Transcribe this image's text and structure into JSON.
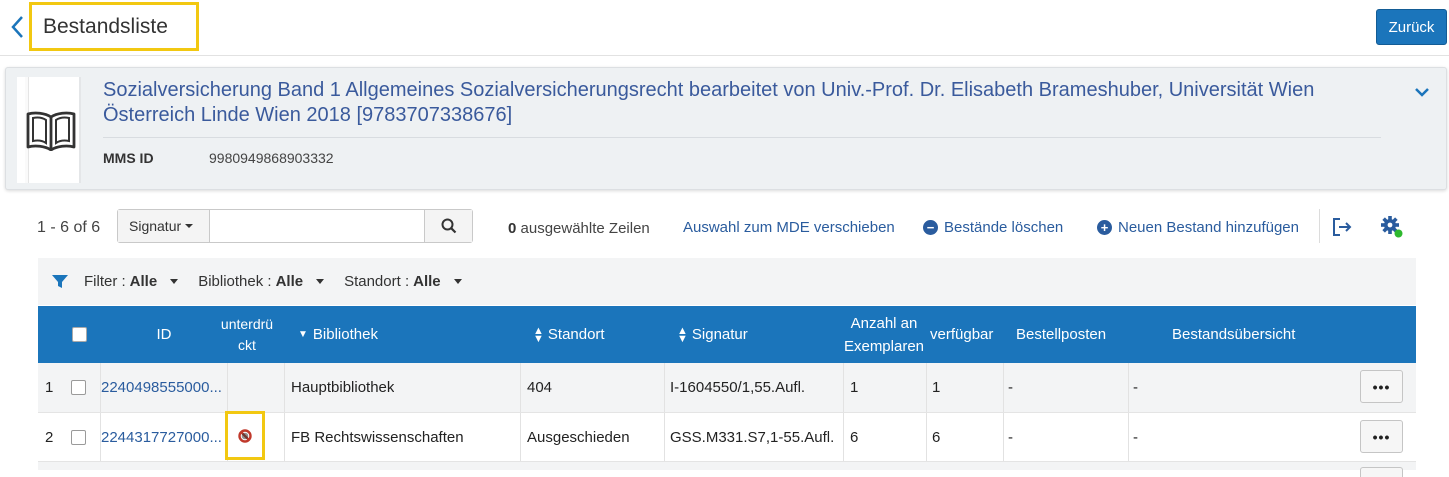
{
  "header": {
    "title": "Bestandsliste",
    "back_button_label": "Zurück"
  },
  "record": {
    "title": "Sozialversicherung Band 1 Allgemeines Sozialversicherungsrecht bearbeitet von Univ.-Prof. Dr. Elisabeth Brameshuber, Universität Wien Österreich Linde Wien 2018 [9783707338676]",
    "mms_label": "MMS ID",
    "mms_value": "9980949868903332",
    "thumbnail_icon": "book-icon"
  },
  "toolbar": {
    "count": "1 - 6 of 6",
    "search_field_select": "Signatur",
    "search_value": "",
    "selected_count": "0",
    "selected_text": "ausgewählte Zeilen",
    "move_to_mde": "Auswahl zum MDE verschieben",
    "delete_holdings": "Bestände löschen",
    "add_holding": "Neuen Bestand hinzufügen"
  },
  "filters": [
    {
      "label": "Filter :",
      "value": "Alle"
    },
    {
      "label": "Bibliothek :",
      "value": "Alle"
    },
    {
      "label": "Standort :",
      "value": "Alle"
    }
  ],
  "table": {
    "columns": {
      "id": "ID",
      "suppressed_line1": "unterdrü",
      "suppressed_line2": "ckt",
      "library": "Bibliothek",
      "location": "Standort",
      "call_number": "Signatur",
      "copies_line1": "Anzahl an",
      "copies_line2": "Exemplaren",
      "available": "verfügbar",
      "orders": "Bestellposten",
      "overview": "Bestandsübersicht"
    },
    "rows": [
      {
        "num": "1",
        "id": "2240498555000...",
        "suppressed": false,
        "library": "Hauptbibliothek",
        "location": "404",
        "call_number": "I-1604550/1,55.Aufl.",
        "copies": "1",
        "available": "1",
        "orders": "-",
        "overview": "-"
      },
      {
        "num": "2",
        "id": "2244317727000...",
        "suppressed": true,
        "library": "FB Rechtswissenschaften",
        "location": "Ausgeschieden",
        "call_number": "GSS.M331.S7,1-55.Aufl.",
        "copies": "6",
        "available": "6",
        "orders": "-",
        "overview": "-"
      }
    ],
    "row_actions_label": "•••"
  },
  "colors": {
    "primary": "#1b75bb",
    "link": "#2a5c9e",
    "highlight": "#f2c811",
    "title_link": "#3a5a9c",
    "suppressed_icon": "#c0392b",
    "gear_status": "#2eb82e"
  }
}
